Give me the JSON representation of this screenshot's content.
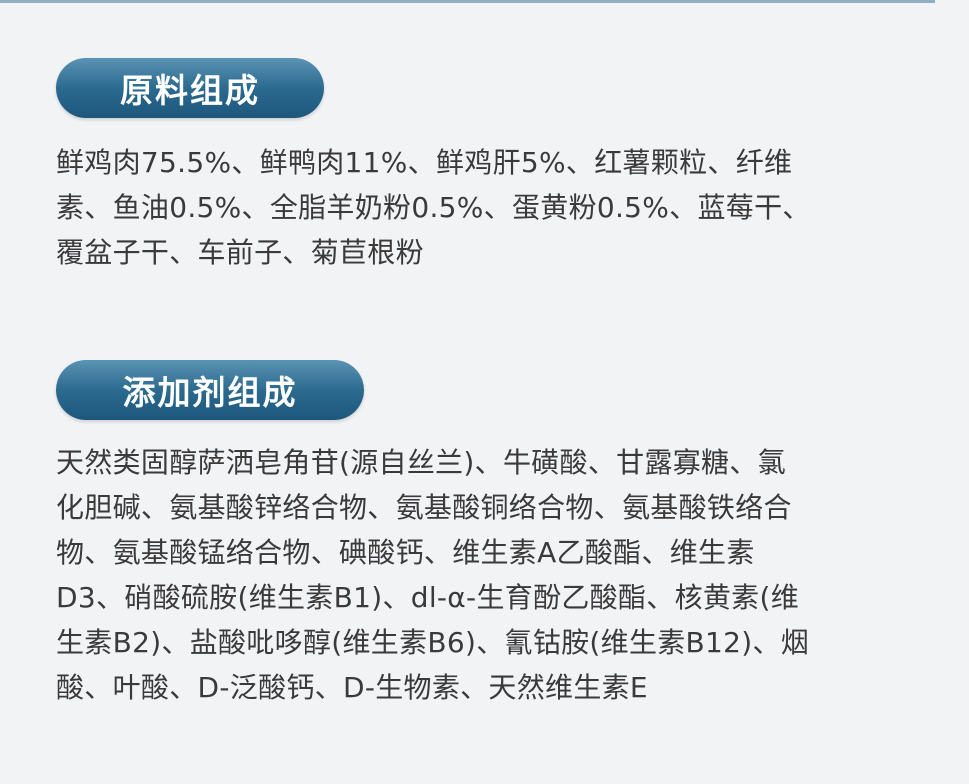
{
  "ingredients": {
    "heading": "原料组成",
    "lines": [
      "鲜鸡肉75.5%、鲜鸭肉11%、鲜鸡肝5%、红薯颗粒、纤维",
      "素、鱼油0.5%、全脂羊奶粉0.5%、蛋黄粉0.5%、蓝莓干、",
      "覆盆子干、车前子、菊苣根粉"
    ]
  },
  "additives": {
    "heading": "添加剂组成",
    "lines": [
      "天然类固醇萨洒皂角苷(源自丝兰)、牛磺酸、甘露寡糖、氯",
      "化胆碱、氨基酸锌络合物、氨基酸铜络合物、氨基酸铁络合",
      "物、氨基酸锰络合物、碘酸钙、维生素A乙酸酯、维生素",
      "D3、硝酸硫胺(维生素B1)、dl-α-生育酚乙酸酯、核黄素(维",
      "生素B2)、盐酸吡哆醇(维生素B6)、氰钴胺(维生素B12)、烟",
      "酸、叶酸、D-泛酸钙、D-生物素、天然维生素E"
    ]
  }
}
